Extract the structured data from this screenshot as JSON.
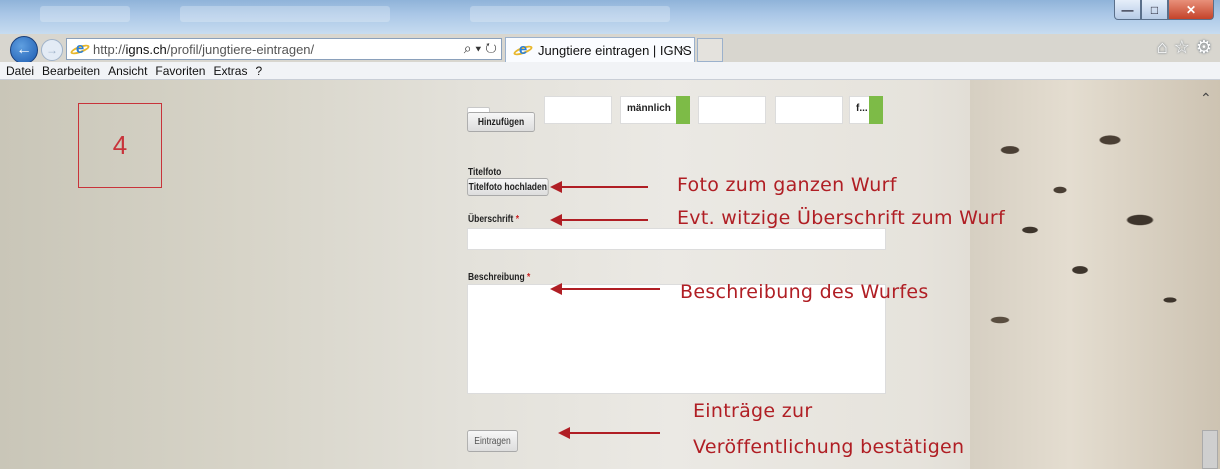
{
  "browser": {
    "url_prefix": "http://",
    "url_domain": "igns.ch",
    "url_path": "/profil/jungtiere-eintragen/",
    "tab_title": "Jungtiere eintragen | IGNS",
    "tab_close": "×",
    "address_icons": "⌕ ▾ ↻",
    "window_buttons": {
      "minimize": "—",
      "maximize": "□",
      "close": "✕"
    },
    "toolbar_icons": {
      "home": "⌂",
      "favorites": "☆",
      "tools": "⚙"
    }
  },
  "menubar": {
    "items": [
      "Datei",
      "Bearbeiten",
      "Ansicht",
      "Favoriten",
      "Extras",
      "?"
    ]
  },
  "page": {
    "step_number": "4",
    "add_button": "Hinzufügen",
    "gender_male": "männlich",
    "gender_female_truncated": "f...",
    "title_photo_label": "Titelfoto",
    "title_photo_button": "Titelfoto hochladen",
    "heading_label": "Überschrift",
    "description_label": "Beschreibung",
    "required_marker": "*",
    "submit_button": "Eintragen"
  },
  "annotations": {
    "photo": "Foto zum ganzen Wurf",
    "heading": "Evt. witzige Überschrift zum Wurf",
    "description": "Beschreibung des Wurfes",
    "submit_line1": "Einträge  zur",
    "submit_line2": "Veröffentlichung bestätigen"
  },
  "colors": {
    "annotation_red": "#b01e24",
    "accent_green": "#7dbb47"
  }
}
